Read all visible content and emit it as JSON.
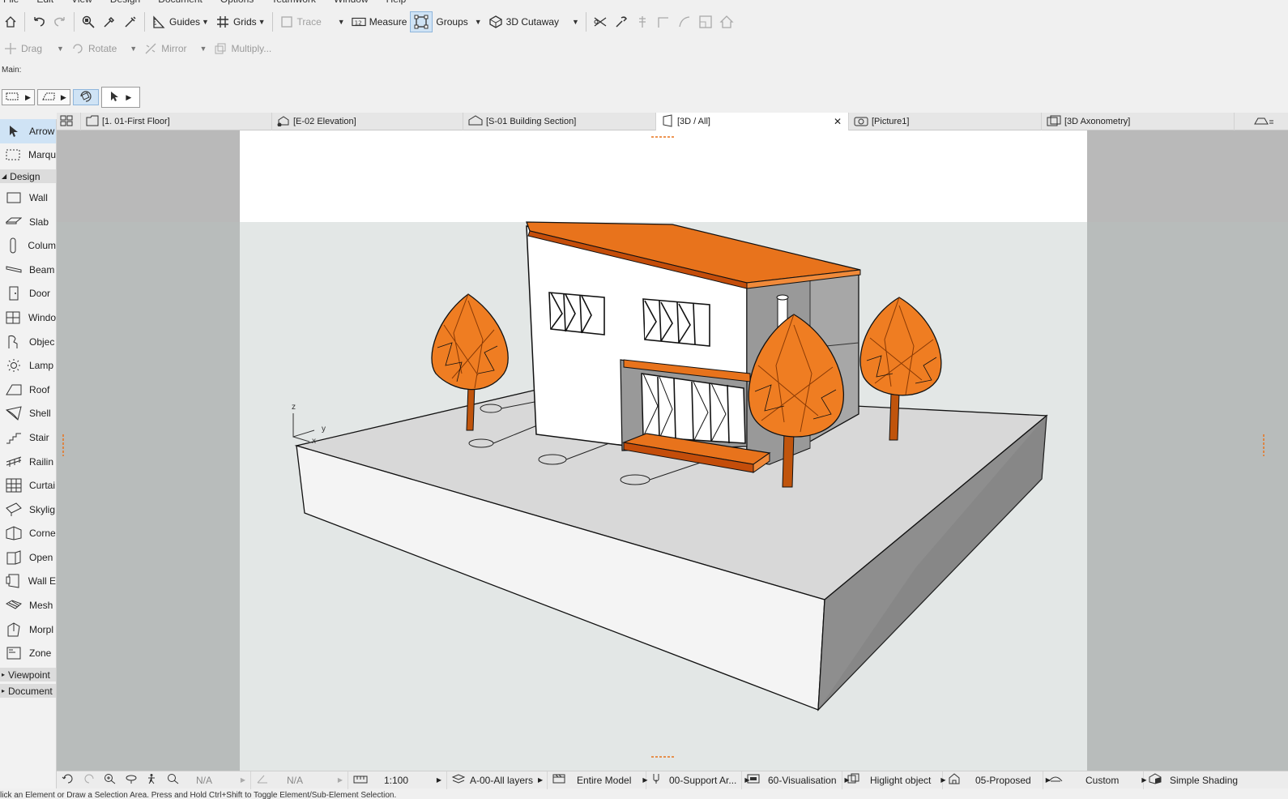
{
  "menu": [
    "File",
    "Edit",
    "View",
    "Design",
    "Document",
    "Options",
    "Teamwork",
    "Window",
    "Help"
  ],
  "toolbar": {
    "guides": "Guides",
    "grids": "Grids",
    "trace": "Trace",
    "measure": "Measure",
    "groups": "Groups",
    "cutaway": "3D Cutaway"
  },
  "toolbar2": {
    "drag": "Drag",
    "rotate": "Rotate",
    "mirror": "Mirror",
    "multiply": "Multiply..."
  },
  "main_label": "Main:",
  "tabs": [
    {
      "label": "[1. 01-First Floor]"
    },
    {
      "label": "[E-02 Elevation]"
    },
    {
      "label": "[S-01 Building Section]"
    },
    {
      "label": "[3D / All]"
    },
    {
      "label": "[Picture1]"
    },
    {
      "label": "[3D Axonometry]"
    }
  ],
  "toolbox": {
    "arrow": "Arrow",
    "marquee": "Marqu",
    "design_section": "Design",
    "tools": [
      "Wall",
      "Slab",
      "Colum",
      "Beam",
      "Door",
      "Windo",
      "Objec",
      "Lamp",
      "Roof",
      "Shell",
      "Stair",
      "Railin",
      "Curtai",
      "Skylig",
      "Corne",
      "Open",
      "Wall E",
      "Mesh",
      "Morpl",
      "Zone"
    ],
    "viewpoint_section": "Viewpoint",
    "document_section": "Document"
  },
  "axis": {
    "z": "z",
    "y": "y",
    "x": "x"
  },
  "status": {
    "na1": "N/A",
    "na2": "N/A",
    "scale": "1:100",
    "layers": "A-00-All layers",
    "model": "Entire Model",
    "pen": "00-Support Ar...",
    "override": "60-Visualisation",
    "highlight": "Higlight object",
    "renovation": "05-Proposed",
    "custom": "Custom",
    "shading": "Simple Shading"
  },
  "hint": "lick an Element or Draw a Selection Area. Press and Hold Ctrl+Shift to Toggle Element/Sub-Element Selection.",
  "colors": {
    "accent_orange": "#e8731c",
    "roof_orange": "#d9560a",
    "selection_blue": "#cfe3f5"
  }
}
